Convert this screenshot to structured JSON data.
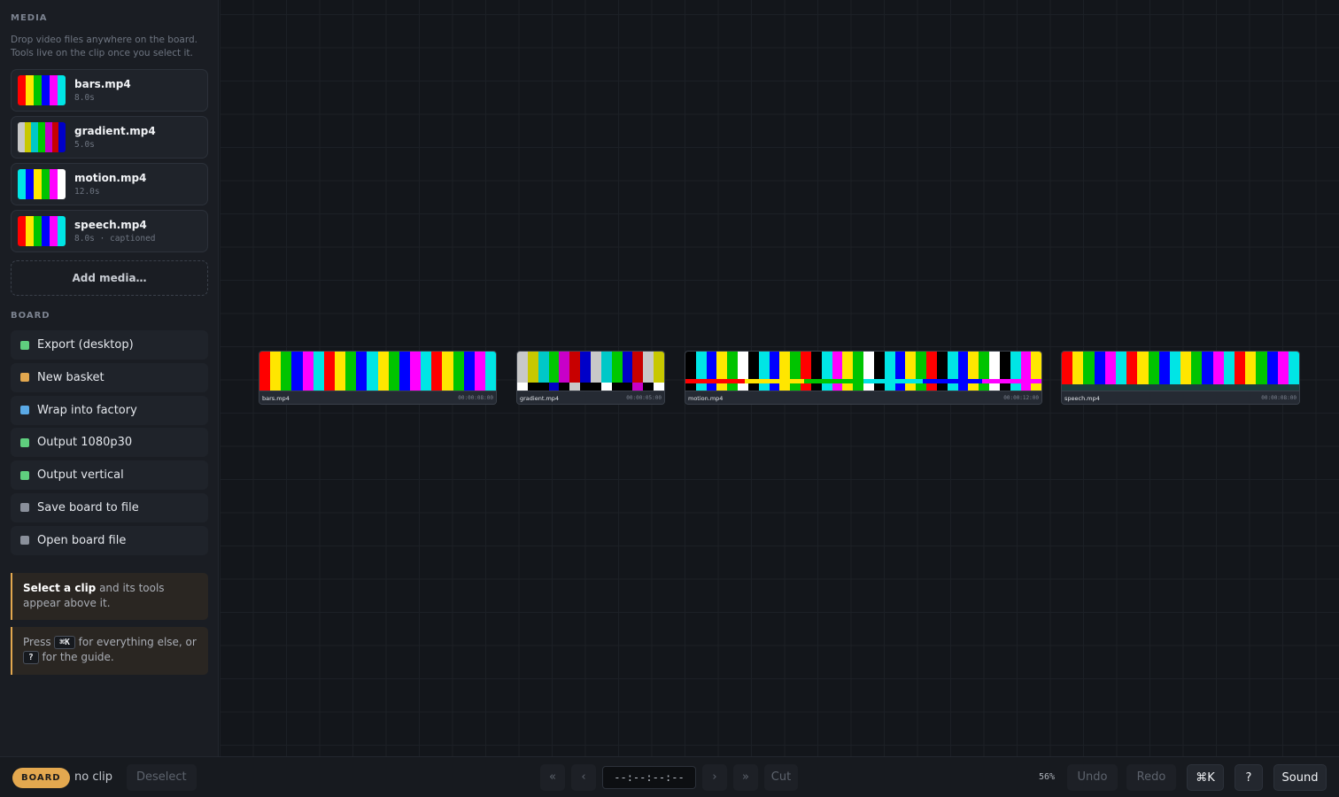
{
  "sidebar": {
    "media_title": "MEDIA",
    "media_hint": "Drop video files anywhere on the board. Tools live on the clip once you select it.",
    "media": [
      {
        "name": "bars.mp4",
        "meta": "8.0s",
        "thumb": [
          "#ff0000",
          "#ffe600",
          "#00c400",
          "#0000ff",
          "#ff00ff",
          "#00e5e5"
        ]
      },
      {
        "name": "gradient.mp4",
        "meta": "5.0s",
        "thumb": [
          "#c8c8c8",
          "#c8c800",
          "#00c8c8",
          "#00c800",
          "#c800c8",
          "#c80000",
          "#0000c8"
        ]
      },
      {
        "name": "motion.mp4",
        "meta": "12.0s",
        "thumb": [
          "#00e5e5",
          "#0000ff",
          "#ffe600",
          "#00c400",
          "#ff00ff",
          "#ffffff"
        ]
      },
      {
        "name": "speech.mp4",
        "meta": "8.0s · captioned",
        "thumb": [
          "#ff0000",
          "#ffe600",
          "#00c400",
          "#0000ff",
          "#ff00ff",
          "#00e5e5"
        ]
      }
    ],
    "add_media": "Add media…",
    "board_title": "BOARD",
    "board_items": [
      {
        "label": "Export (desktop)",
        "color": "#5fcf7e"
      },
      {
        "label": "New basket",
        "color": "#e3a84f"
      },
      {
        "label": "Wrap into factory",
        "color": "#5aa9e6"
      },
      {
        "label": "Output 1080p30",
        "color": "#5fcf7e"
      },
      {
        "label": "Output vertical",
        "color": "#5fcf7e"
      },
      {
        "label": "Save board to file",
        "color": "#8a909b"
      },
      {
        "label": "Open board file",
        "color": "#8a909b"
      }
    ],
    "tip1": {
      "bold": "Select a clip",
      "rest": " and its tools appear above it."
    },
    "tip2": {
      "pre": "Press ",
      "key1": "⌘K",
      "mid": " for everything else, or ",
      "key2": "?",
      "post": " for the guide."
    }
  },
  "clips": [
    {
      "name": "bars.mp4",
      "timecode": "00:00:08:00"
    },
    {
      "name": "gradient.mp4",
      "timecode": "00:00:05:00"
    },
    {
      "name": "motion.mp4",
      "timecode": "00:00:12:00"
    },
    {
      "name": "speech.mp4",
      "timecode": "00:00:08:00"
    }
  ],
  "bottombar": {
    "mode": "BOARD",
    "selection": "no clip",
    "deselect": "Deselect",
    "first": "«",
    "prev": "‹",
    "timecode": "--:--:--:--",
    "next": "›",
    "last": "»",
    "cut": "Cut",
    "zoom": "56%",
    "undo": "Undo",
    "redo": "Redo",
    "palette": "⌘K",
    "help": "?",
    "sound": "Sound"
  },
  "colors": {
    "accent": "#e3a84f",
    "background": "#13161b"
  }
}
